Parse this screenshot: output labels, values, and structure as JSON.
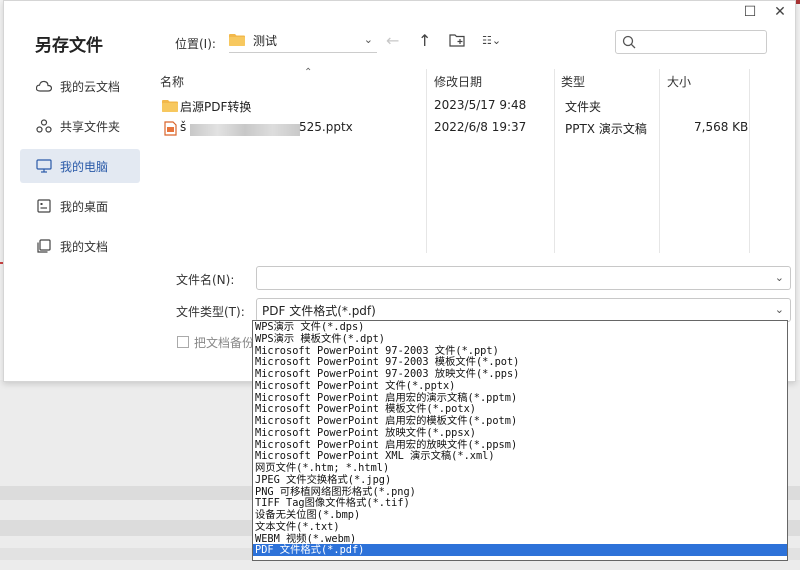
{
  "dialog": {
    "title": "另存文件",
    "minimize_label": "☐",
    "close_label": "✕"
  },
  "toolbar": {
    "location_label": "位置(I):",
    "location_value": "测试",
    "search_placeholder": ""
  },
  "sidebar": {
    "items": [
      {
        "label": "我的云文档",
        "icon": "cloud-icon"
      },
      {
        "label": "共享文件夹",
        "icon": "share-icon"
      },
      {
        "label": "我的电脑",
        "icon": "computer-icon"
      },
      {
        "label": "我的桌面",
        "icon": "desktop-icon"
      },
      {
        "label": "我的文档",
        "icon": "documents-icon"
      }
    ]
  },
  "file_list": {
    "headers": {
      "name": "名称",
      "modified": "修改日期",
      "type": "类型",
      "size": "大小"
    },
    "rows": [
      {
        "name": "启源PDF转换",
        "modified": "2023/5/17 9:48",
        "type": "文件夹",
        "size": "",
        "icon": "folder-icon"
      },
      {
        "name_prefix": "š",
        "name_suffix": "525.pptx",
        "modified": "2022/6/8 19:37",
        "type": "PPTX 演示文稿",
        "size": "7,568 KB",
        "icon": "pptx-file-icon"
      }
    ]
  },
  "form": {
    "filename_label": "文件名(N):",
    "filename_value": "",
    "filetype_label": "文件类型(T):",
    "filetype_value": "PDF 文件格式(*.pdf)",
    "backup_label": "把文档备份到"
  },
  "filetype_options": [
    "WPS演示 文件(*.dps)",
    "WPS演示 模板文件(*.dpt)",
    "Microsoft PowerPoint 97-2003 文件(*.ppt)",
    "Microsoft PowerPoint 97-2003 模板文件(*.pot)",
    "Microsoft PowerPoint 97-2003 放映文件(*.pps)",
    "Microsoft PowerPoint 文件(*.pptx)",
    "Microsoft PowerPoint 启用宏的演示文稿(*.pptm)",
    "Microsoft PowerPoint 模板文件(*.potx)",
    "Microsoft PowerPoint 启用宏的模板文件(*.potm)",
    "Microsoft PowerPoint 放映文件(*.ppsx)",
    "Microsoft PowerPoint 启用宏的放映文件(*.ppsm)",
    "Microsoft PowerPoint XML 演示文稿(*.xml)",
    "网页文件(*.htm; *.html)",
    "JPEG 文件交换格式(*.jpg)",
    "PNG 可移植网络图形格式(*.png)",
    "TIFF Tag图像文件格式(*.tif)",
    "设备无关位图(*.bmp)",
    "文本文件(*.txt)",
    "WEBM 视频(*.webm)",
    "PDF 文件格式(*.pdf)"
  ],
  "selected_option_index": 19,
  "colors": {
    "accent": "#2d72d9",
    "folder": "#f2b84b",
    "sidebar_active_bg": "#e3e9f2"
  }
}
